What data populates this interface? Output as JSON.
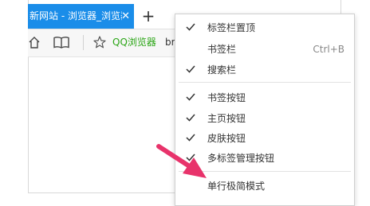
{
  "tab": {
    "title": "新网站 - 浏览器_浏览器",
    "close_glyph": "✕"
  },
  "new_tab_glyph": "+",
  "toolbar": {
    "bookmarks": [
      {
        "label": "QQ浏览器"
      },
      {
        "label": "br"
      }
    ]
  },
  "menu": {
    "items": [
      {
        "label": "标签栏置顶",
        "checked": true,
        "shortcut": ""
      },
      {
        "label": "书签栏",
        "checked": false,
        "shortcut": "Ctrl+B"
      },
      {
        "label": "搜索栏",
        "checked": true,
        "shortcut": ""
      },
      {
        "label": "书签按钮",
        "checked": true,
        "shortcut": ""
      },
      {
        "label": "主页按钮",
        "checked": true,
        "shortcut": ""
      },
      {
        "label": "皮肤按钮",
        "checked": true,
        "shortcut": ""
      },
      {
        "label": "多标签管理按钮",
        "checked": true,
        "shortcut": ""
      },
      {
        "label": "单行极简模式",
        "checked": false,
        "shortcut": ""
      }
    ]
  },
  "colors": {
    "tab_active": "#1a8de9",
    "qq_bookmark": "#2aa515",
    "annotation_arrow": "#e8336b"
  },
  "icons": [
    "home-icon",
    "bookmark-book-icon",
    "star-icon",
    "check-icon",
    "arrow-annotation"
  ]
}
